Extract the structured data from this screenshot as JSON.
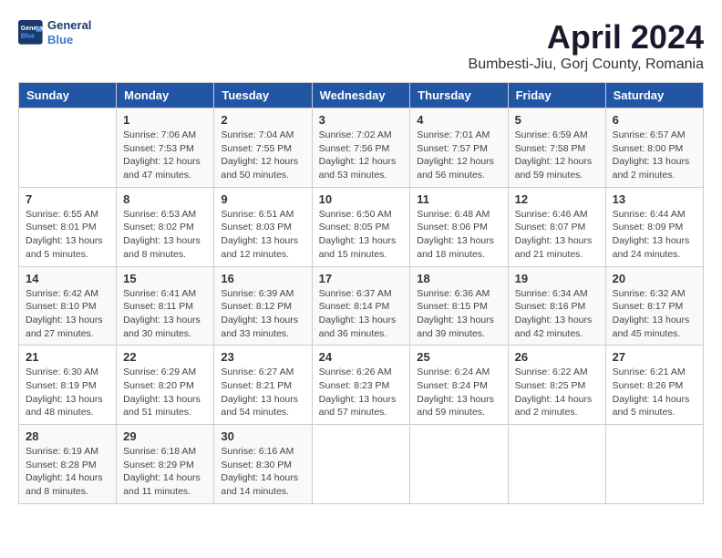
{
  "header": {
    "logo_line1": "General",
    "logo_line2": "Blue",
    "month_title": "April 2024",
    "subtitle": "Bumbesti-Jiu, Gorj County, Romania"
  },
  "days_of_week": [
    "Sunday",
    "Monday",
    "Tuesday",
    "Wednesday",
    "Thursday",
    "Friday",
    "Saturday"
  ],
  "weeks": [
    [
      {
        "day": "",
        "sunrise": "",
        "sunset": "",
        "daylight": ""
      },
      {
        "day": "1",
        "sunrise": "Sunrise: 7:06 AM",
        "sunset": "Sunset: 7:53 PM",
        "daylight": "Daylight: 12 hours and 47 minutes."
      },
      {
        "day": "2",
        "sunrise": "Sunrise: 7:04 AM",
        "sunset": "Sunset: 7:55 PM",
        "daylight": "Daylight: 12 hours and 50 minutes."
      },
      {
        "day": "3",
        "sunrise": "Sunrise: 7:02 AM",
        "sunset": "Sunset: 7:56 PM",
        "daylight": "Daylight: 12 hours and 53 minutes."
      },
      {
        "day": "4",
        "sunrise": "Sunrise: 7:01 AM",
        "sunset": "Sunset: 7:57 PM",
        "daylight": "Daylight: 12 hours and 56 minutes."
      },
      {
        "day": "5",
        "sunrise": "Sunrise: 6:59 AM",
        "sunset": "Sunset: 7:58 PM",
        "daylight": "Daylight: 12 hours and 59 minutes."
      },
      {
        "day": "6",
        "sunrise": "Sunrise: 6:57 AM",
        "sunset": "Sunset: 8:00 PM",
        "daylight": "Daylight: 13 hours and 2 minutes."
      }
    ],
    [
      {
        "day": "7",
        "sunrise": "Sunrise: 6:55 AM",
        "sunset": "Sunset: 8:01 PM",
        "daylight": "Daylight: 13 hours and 5 minutes."
      },
      {
        "day": "8",
        "sunrise": "Sunrise: 6:53 AM",
        "sunset": "Sunset: 8:02 PM",
        "daylight": "Daylight: 13 hours and 8 minutes."
      },
      {
        "day": "9",
        "sunrise": "Sunrise: 6:51 AM",
        "sunset": "Sunset: 8:03 PM",
        "daylight": "Daylight: 13 hours and 12 minutes."
      },
      {
        "day": "10",
        "sunrise": "Sunrise: 6:50 AM",
        "sunset": "Sunset: 8:05 PM",
        "daylight": "Daylight: 13 hours and 15 minutes."
      },
      {
        "day": "11",
        "sunrise": "Sunrise: 6:48 AM",
        "sunset": "Sunset: 8:06 PM",
        "daylight": "Daylight: 13 hours and 18 minutes."
      },
      {
        "day": "12",
        "sunrise": "Sunrise: 6:46 AM",
        "sunset": "Sunset: 8:07 PM",
        "daylight": "Daylight: 13 hours and 21 minutes."
      },
      {
        "day": "13",
        "sunrise": "Sunrise: 6:44 AM",
        "sunset": "Sunset: 8:09 PM",
        "daylight": "Daylight: 13 hours and 24 minutes."
      }
    ],
    [
      {
        "day": "14",
        "sunrise": "Sunrise: 6:42 AM",
        "sunset": "Sunset: 8:10 PM",
        "daylight": "Daylight: 13 hours and 27 minutes."
      },
      {
        "day": "15",
        "sunrise": "Sunrise: 6:41 AM",
        "sunset": "Sunset: 8:11 PM",
        "daylight": "Daylight: 13 hours and 30 minutes."
      },
      {
        "day": "16",
        "sunrise": "Sunrise: 6:39 AM",
        "sunset": "Sunset: 8:12 PM",
        "daylight": "Daylight: 13 hours and 33 minutes."
      },
      {
        "day": "17",
        "sunrise": "Sunrise: 6:37 AM",
        "sunset": "Sunset: 8:14 PM",
        "daylight": "Daylight: 13 hours and 36 minutes."
      },
      {
        "day": "18",
        "sunrise": "Sunrise: 6:36 AM",
        "sunset": "Sunset: 8:15 PM",
        "daylight": "Daylight: 13 hours and 39 minutes."
      },
      {
        "day": "19",
        "sunrise": "Sunrise: 6:34 AM",
        "sunset": "Sunset: 8:16 PM",
        "daylight": "Daylight: 13 hours and 42 minutes."
      },
      {
        "day": "20",
        "sunrise": "Sunrise: 6:32 AM",
        "sunset": "Sunset: 8:17 PM",
        "daylight": "Daylight: 13 hours and 45 minutes."
      }
    ],
    [
      {
        "day": "21",
        "sunrise": "Sunrise: 6:30 AM",
        "sunset": "Sunset: 8:19 PM",
        "daylight": "Daylight: 13 hours and 48 minutes."
      },
      {
        "day": "22",
        "sunrise": "Sunrise: 6:29 AM",
        "sunset": "Sunset: 8:20 PM",
        "daylight": "Daylight: 13 hours and 51 minutes."
      },
      {
        "day": "23",
        "sunrise": "Sunrise: 6:27 AM",
        "sunset": "Sunset: 8:21 PM",
        "daylight": "Daylight: 13 hours and 54 minutes."
      },
      {
        "day": "24",
        "sunrise": "Sunrise: 6:26 AM",
        "sunset": "Sunset: 8:23 PM",
        "daylight": "Daylight: 13 hours and 57 minutes."
      },
      {
        "day": "25",
        "sunrise": "Sunrise: 6:24 AM",
        "sunset": "Sunset: 8:24 PM",
        "daylight": "Daylight: 13 hours and 59 minutes."
      },
      {
        "day": "26",
        "sunrise": "Sunrise: 6:22 AM",
        "sunset": "Sunset: 8:25 PM",
        "daylight": "Daylight: 14 hours and 2 minutes."
      },
      {
        "day": "27",
        "sunrise": "Sunrise: 6:21 AM",
        "sunset": "Sunset: 8:26 PM",
        "daylight": "Daylight: 14 hours and 5 minutes."
      }
    ],
    [
      {
        "day": "28",
        "sunrise": "Sunrise: 6:19 AM",
        "sunset": "Sunset: 8:28 PM",
        "daylight": "Daylight: 14 hours and 8 minutes."
      },
      {
        "day": "29",
        "sunrise": "Sunrise: 6:18 AM",
        "sunset": "Sunset: 8:29 PM",
        "daylight": "Daylight: 14 hours and 11 minutes."
      },
      {
        "day": "30",
        "sunrise": "Sunrise: 6:16 AM",
        "sunset": "Sunset: 8:30 PM",
        "daylight": "Daylight: 14 hours and 14 minutes."
      },
      {
        "day": "",
        "sunrise": "",
        "sunset": "",
        "daylight": ""
      },
      {
        "day": "",
        "sunrise": "",
        "sunset": "",
        "daylight": ""
      },
      {
        "day": "",
        "sunrise": "",
        "sunset": "",
        "daylight": ""
      },
      {
        "day": "",
        "sunrise": "",
        "sunset": "",
        "daylight": ""
      }
    ]
  ]
}
